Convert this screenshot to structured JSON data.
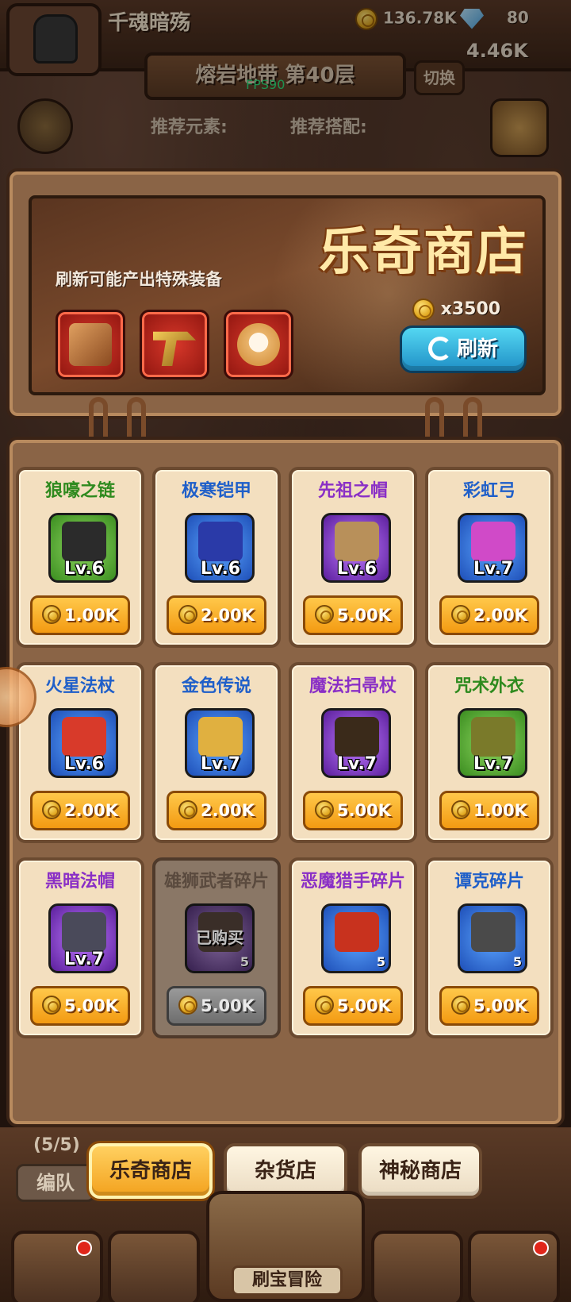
{
  "hud": {
    "player_name": "千魂暗殇",
    "gold": "136.78K",
    "gems": "80",
    "energy": "4.46K",
    "level_title": "熔岩地带 第40层",
    "fps": "FPS90",
    "switch_label": "切换",
    "recommend_element_label": "推荐元素:",
    "recommend_combo_label": "推荐搭配:"
  },
  "shop": {
    "title": "乐奇商店",
    "subtitle": "刷新可能产出特殊装备",
    "refresh_cost": "x3500",
    "refresh_label": "刷新",
    "special_items": [
      "book-item-icon",
      "golden-revolver-icon",
      "shiba-dog-icon"
    ]
  },
  "items": [
    {
      "name": "狼嚎之链",
      "name_color": "#2e8a1e",
      "rarity": "green",
      "level": "Lv.6",
      "price": "1.00K",
      "icon": "chain-necklace-icon"
    },
    {
      "name": "极寒铠甲",
      "name_color": "#1f5fc9",
      "rarity": "blue",
      "level": "Lv.6",
      "price": "2.00K",
      "icon": "armor-icon"
    },
    {
      "name": "先祖之帽",
      "name_color": "#8a2fc6",
      "rarity": "purple",
      "level": "Lv.6",
      "price": "5.00K",
      "icon": "feather-headdress-icon"
    },
    {
      "name": "彩虹弓",
      "name_color": "#1f5fc9",
      "rarity": "blue",
      "level": "Lv.7",
      "price": "2.00K",
      "icon": "rainbow-bow-icon"
    },
    {
      "name": "火星法杖",
      "name_color": "#1f5fc9",
      "rarity": "blue",
      "level": "Lv.6",
      "price": "2.00K",
      "icon": "star-staff-icon"
    },
    {
      "name": "金色传说",
      "name_color": "#1f5fc9",
      "rarity": "blue",
      "level": "Lv.7",
      "price": "2.00K",
      "icon": "golden-armor-icon"
    },
    {
      "name": "魔法扫帚杖",
      "name_color": "#8a2fc6",
      "rarity": "purple",
      "level": "Lv.7",
      "price": "5.00K",
      "icon": "broom-staff-icon"
    },
    {
      "name": "咒术外衣",
      "name_color": "#2e8a1e",
      "rarity": "green",
      "level": "Lv.7",
      "price": "1.00K",
      "icon": "cursed-robe-icon"
    },
    {
      "name": "黑暗法帽",
      "name_color": "#8a2fc6",
      "rarity": "purple",
      "level": "Lv.7",
      "price": "5.00K",
      "icon": "dark-wizard-hat-icon"
    },
    {
      "name": "雄狮武者碎片",
      "name_color": "#5a4a3e",
      "rarity": "purple",
      "level": "",
      "price": "5.00K",
      "icon": "lion-warrior-shard-icon",
      "bought_label": "已购买",
      "count": "5",
      "sold": true
    },
    {
      "name": "恶魔猎手碎片",
      "name_color": "#8a2fc6",
      "rarity": "blue",
      "level": "",
      "price": "5.00K",
      "icon": "demon-hunter-shard-icon",
      "count": "5"
    },
    {
      "name": "谭克碎片",
      "name_color": "#1f5fc9",
      "rarity": "blue",
      "level": "",
      "price": "5.00K",
      "icon": "tank-shard-icon",
      "count": "5"
    }
  ],
  "bottom": {
    "team_count": "(5/5)",
    "team_label": "编队",
    "tabs": [
      "乐奇商店",
      "杂货店",
      "神秘商店"
    ],
    "active_tab": 0,
    "center_label": "刷宝冒险"
  }
}
